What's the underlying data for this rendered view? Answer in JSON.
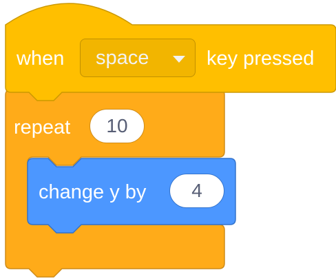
{
  "event_block": {
    "when_label": "when",
    "key_dropdown_value": "space",
    "suffix_label": "key pressed"
  },
  "repeat_block": {
    "label": "repeat",
    "count": "10"
  },
  "motion_block": {
    "label": "change y by",
    "value": "4"
  },
  "colors": {
    "event": "#ffbf00",
    "event_border": "#cc9900",
    "control": "#ffab19",
    "control_border": "#cf8b17",
    "motion": "#4c97ff",
    "motion_border": "#3373cc",
    "text": "#ffffff",
    "input_text": "#575e75"
  }
}
